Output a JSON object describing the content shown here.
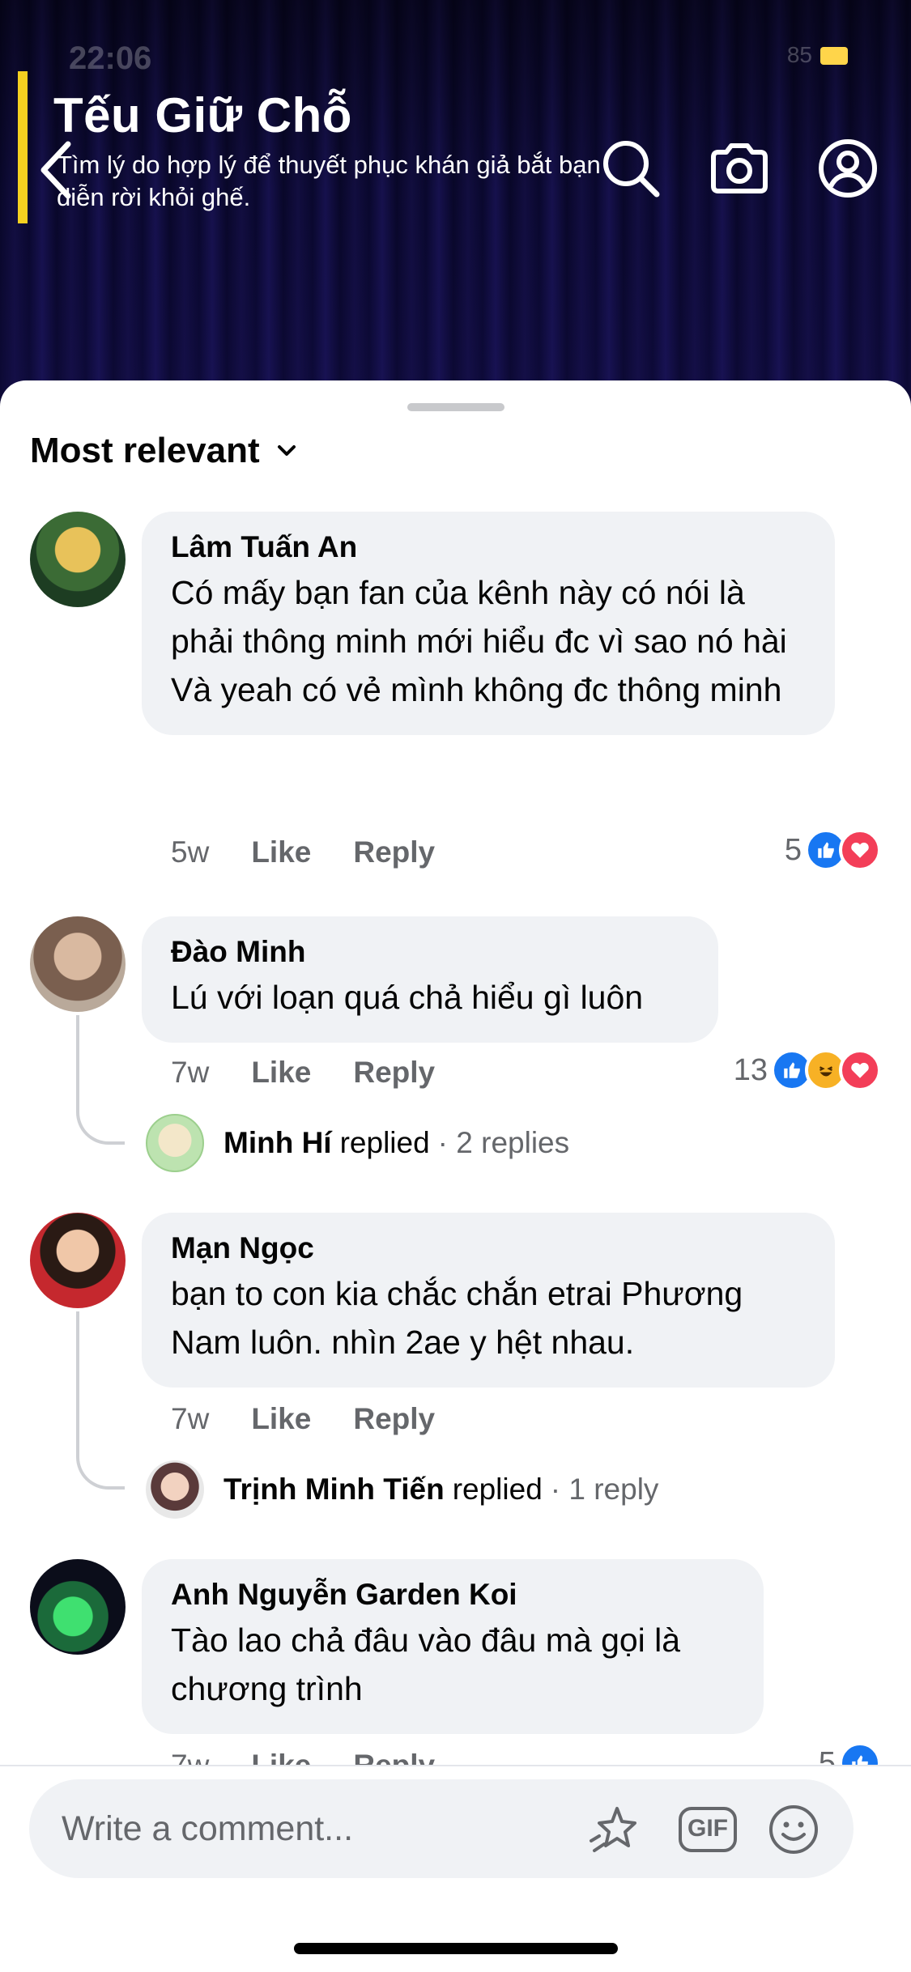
{
  "status_bar": {
    "time": "22:06",
    "battery_label": "85"
  },
  "video": {
    "title": "Tếu Giữ Chỗ",
    "subtitle": "Tìm lý do hợp lý để thuyết phục khán giả bắt bạn diễn rời khỏi ghế."
  },
  "sort": {
    "label": "Most relevant"
  },
  "comments": [
    {
      "author": "Lâm Tuấn An",
      "text": "Có mấy bạn fan của kênh này có nói là phải thông minh mới hiểu đc vì sao nó hài\nVà yeah có vẻ mình không đc thông minh",
      "time": "5w",
      "like_label": "Like",
      "reply_label": "Reply",
      "reaction_count": "5",
      "reactions": [
        "like",
        "love"
      ]
    },
    {
      "author": "Đào Minh",
      "text": "Lú với loạn quá chả hiểu gì luôn",
      "time": "7w",
      "like_label": "Like",
      "reply_label": "Reply",
      "reaction_count": "13",
      "reactions": [
        "like",
        "haha",
        "love"
      ],
      "replies": {
        "name": "Minh Hí",
        "verb": "replied",
        "count_text": "· 2 replies"
      }
    },
    {
      "author": "Mạn Ngọc",
      "text": "bạn to con kia chắc chắn etrai Phương Nam luôn. nhìn 2ae y hệt nhau.",
      "time": "7w",
      "like_label": "Like",
      "reply_label": "Reply",
      "replies": {
        "name": "Trịnh Minh Tiến",
        "verb": "replied",
        "count_text": "· 1 reply"
      }
    },
    {
      "author": "Anh Nguyễn Garden Koi",
      "text": "Tào lao chả đâu vào đâu mà gọi là chương trình",
      "time": "7w",
      "like_label": "Like",
      "reply_label": "Reply",
      "reaction_count": "5",
      "reactions": [
        "like"
      ]
    }
  ],
  "composer": {
    "placeholder": "Write a comment...",
    "gif_label": "GIF"
  },
  "colors": {
    "accent": "#1877f2",
    "love": "#f33e58",
    "haha": "#f7b125",
    "title_bar": "#f5d020"
  }
}
